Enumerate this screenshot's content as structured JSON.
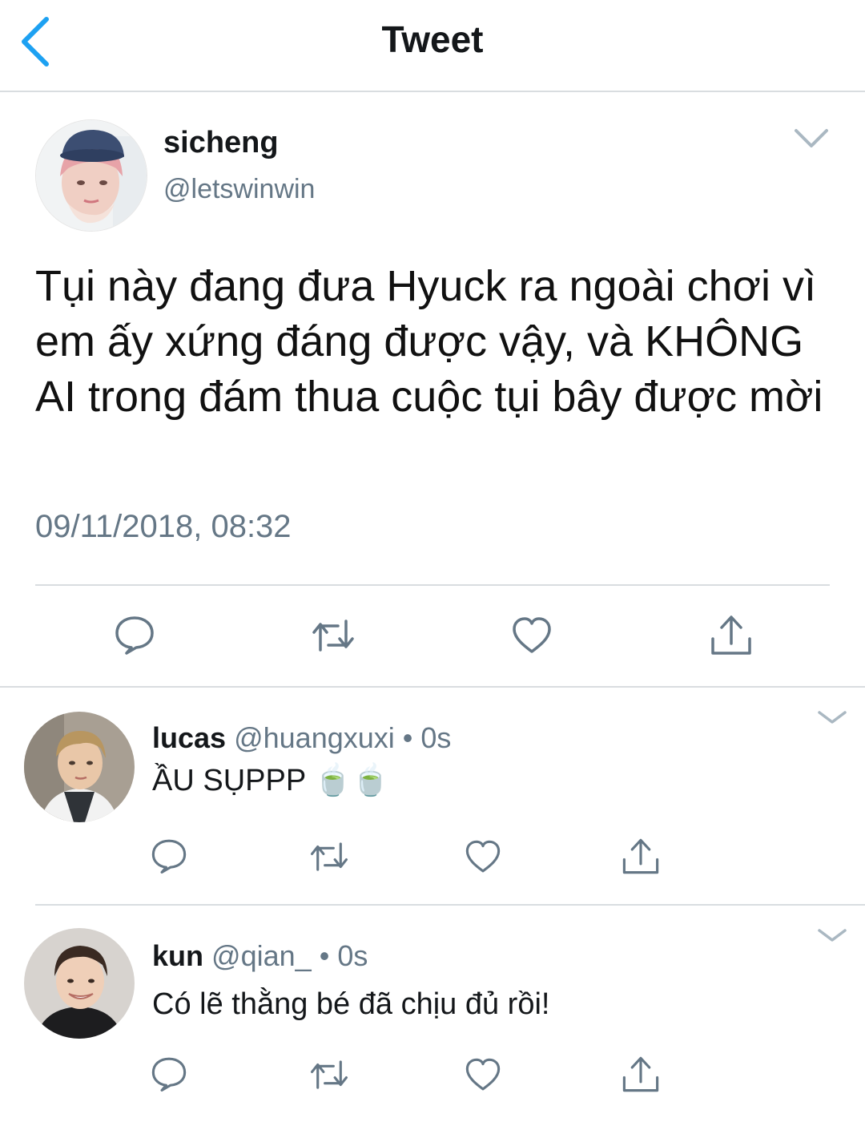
{
  "header": {
    "title": "Tweet"
  },
  "main_tweet": {
    "name": "sicheng",
    "handle": "@letswinwin",
    "text": "Tụi này đang đưa Hyuck ra ngoài chơi vì em ấy xứng đáng được vậy, và KHÔNG AI trong đám thua cuộc tụi bây được mời",
    "timestamp": "09/11/2018, 08:32"
  },
  "replies": [
    {
      "name": "lucas",
      "handle": "@huangxuxi",
      "dot": "•",
      "time": "0s",
      "text": "ẦU SỤPPP 🍵🍵"
    },
    {
      "name": "kun",
      "handle": "@qian_",
      "dot": "•",
      "time": "0s",
      "text": "Có lẽ thằng bé đã chịu đủ rồi!"
    }
  ],
  "icons": {
    "back": "chevron-left-icon",
    "menu": "chevron-down-icon",
    "reply": "speech-bubble-icon",
    "retweet": "retweet-icon",
    "like": "heart-icon",
    "share": "share-icon"
  },
  "colors": {
    "accent": "#1da1f2",
    "icon": "#657786",
    "divider": "#d9dde0",
    "text": "#14171a"
  }
}
